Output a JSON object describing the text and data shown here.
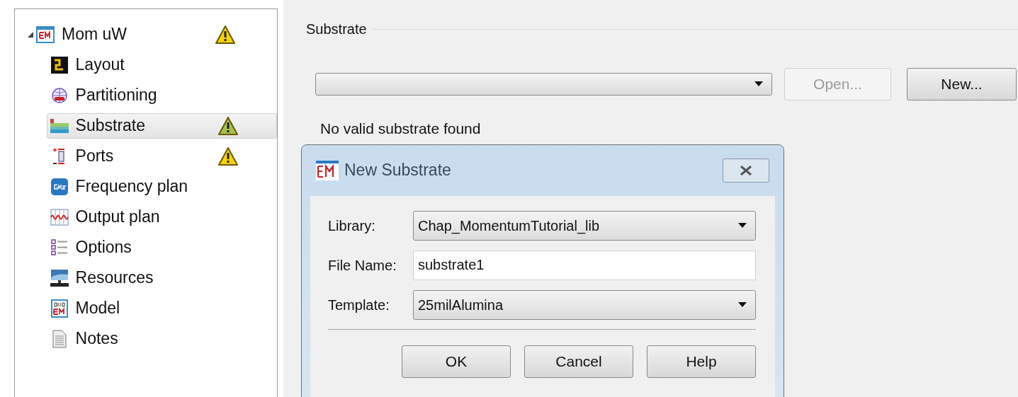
{
  "tree": {
    "label": "Mom uW",
    "expanded": true,
    "warning": true,
    "selected": false,
    "children": [
      {
        "label": "Layout",
        "warning": false,
        "selected": false
      },
      {
        "label": "Partitioning",
        "warning": false,
        "selected": false
      },
      {
        "label": "Substrate",
        "warning": true,
        "selected": true
      },
      {
        "label": "Ports",
        "warning": true,
        "selected": false
      },
      {
        "label": "Frequency plan",
        "warning": false,
        "selected": false
      },
      {
        "label": "Output plan",
        "warning": false,
        "selected": false
      },
      {
        "label": "Options",
        "warning": false,
        "selected": false
      },
      {
        "label": "Resources",
        "warning": false,
        "selected": false
      },
      {
        "label": "Model",
        "warning": false,
        "selected": false
      },
      {
        "label": "Notes",
        "warning": false,
        "selected": false
      }
    ]
  },
  "group": {
    "title": "Substrate",
    "buttons": [
      {
        "label": "Open...",
        "disabled": true
      },
      {
        "label": "New...",
        "disabled": false
      }
    ],
    "message": "No valid substrate found"
  },
  "dialog": {
    "title": "New Substrate",
    "fields": [
      {
        "kind": "dropdown",
        "label": "Library:",
        "value": "Chap_MomentumTutorial_lib"
      },
      {
        "kind": "text",
        "label": "File Name:",
        "value": "substrate1"
      },
      {
        "kind": "dropdown",
        "label": "Template:",
        "value": "25milAlumina"
      }
    ],
    "buttons": [
      "OK",
      "Cancel",
      "Help"
    ]
  }
}
